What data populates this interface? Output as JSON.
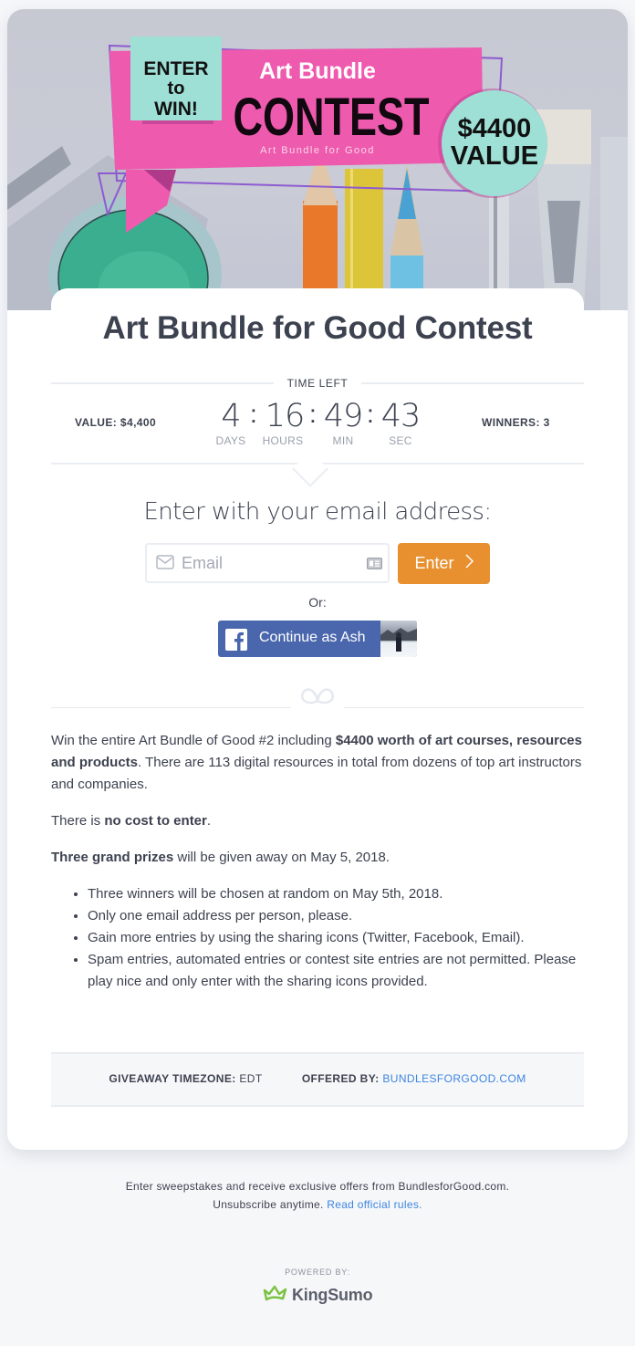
{
  "hero": {
    "badge_enter": "ENTER",
    "badge_to": "to",
    "badge_win": "WIN!",
    "banner_title": "Art Bundle",
    "banner_contest": "CONTEST",
    "banner_subtitle": "Art Bundle for Good",
    "value_amount": "$4400",
    "value_label": "VALUE",
    "colors": {
      "pink": "#ee5aae",
      "teal": "#9ee0d6",
      "purple": "#8d5bd0"
    }
  },
  "contest": {
    "title": "Art Bundle for Good Contest",
    "time_left_label": "TIME LEFT",
    "value_label": "VALUE:",
    "value": "$4,400",
    "winners_label": "WINNERS:",
    "winners": "3",
    "countdown": {
      "days": "4",
      "hours": "16",
      "min": "49",
      "sec": "43",
      "days_label": "DAYS",
      "hours_label": "HOURS",
      "min_label": "MIN",
      "sec_label": "SEC"
    }
  },
  "entry": {
    "heading": "Enter with your email address:",
    "email_placeholder": "Email",
    "email_value": "",
    "enter_button": "Enter",
    "or_label": "Or:",
    "facebook_button": "Continue as Ash",
    "accent_color": "#e8902f",
    "facebook_color": "#4a67ad"
  },
  "description": {
    "p1_a": "Win the entire Art Bundle of Good #2 including ",
    "p1_b": "$4400 worth of art courses, resources and products",
    "p1_c": ". There are 113 digital resources in total from dozens of top art instructors and companies.",
    "p2_a": "There is ",
    "p2_b": "no cost to enter",
    "p2_c": ".",
    "p3_b": "Three grand prizes",
    "p3_c": " will be given away on May 5, 2018.",
    "rules": [
      "Three winners will be chosen at random on May 5th, 2018.",
      "Only one email address per person, please.",
      "Gain more entries by using the sharing icons (Twitter, Facebook, Email).",
      "Spam entries, automated entries or contest site entries are not permitted. Please play nice and only enter with the sharing icons provided."
    ]
  },
  "info_bar": {
    "timezone_label": "GIVEAWAY TIMEZONE:",
    "timezone": "EDT",
    "offered_label": "OFFERED BY:",
    "offered_by": "BUNDLESFORGOOD.COM",
    "link_color": "#3d86e0"
  },
  "footer": {
    "line1": "Enter sweepstakes and receive exclusive offers from BundlesforGood.com.",
    "line2": "Unsubscribe anytime.",
    "rules_link": "Read official rules.",
    "powered_by": "POWERED BY:",
    "brand": "KingSumo"
  }
}
